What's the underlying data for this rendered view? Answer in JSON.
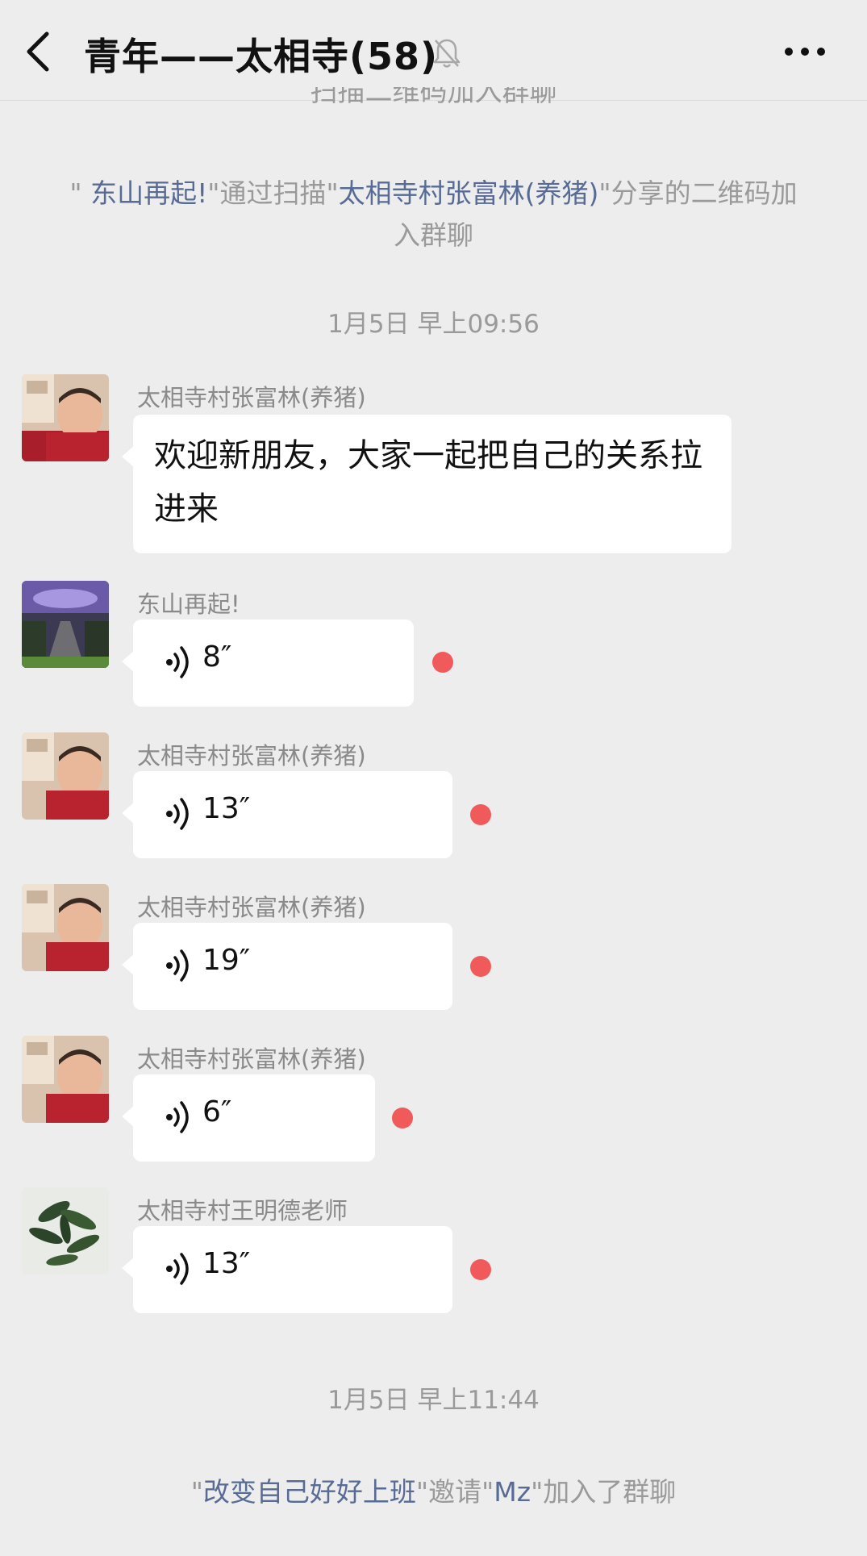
{
  "header": {
    "title": "青年——太相寺(58)",
    "back_icon": "chevron-left-icon",
    "mute_icon": "bell-off-icon",
    "more_icon": "more-horizontal-icon"
  },
  "cutoff_text": "扫描二维码加入群聊",
  "system_messages": [
    {
      "q1": "\"",
      "user": " 东山再起!",
      "mid": "\"通过扫描\"",
      "sharer": "太相寺村张富林(养猪)",
      "tail": "\"分享的二维码加入群聊"
    },
    {
      "q1": "\"",
      "user": "改变自己好好上班",
      "mid": "\"邀请\"",
      "sharer": "Mz",
      "tail": "\"加入了群聊"
    }
  ],
  "times": [
    "1月5日 早上09:56",
    "1月5日 早上11:44"
  ],
  "messages": [
    {
      "sender": "太相寺村张富林(养猪)",
      "text": "欢迎新朋友，大家一起把自己的关系拉进来"
    },
    {
      "sender": "东山再起!",
      "duration": "8″"
    },
    {
      "sender": "太相寺村张富林(养猪)",
      "duration": "13″"
    },
    {
      "sender": "太相寺村张富林(养猪)",
      "duration": "19″"
    },
    {
      "sender": "太相寺村张富林(养猪)",
      "duration": "6″"
    },
    {
      "sender": "太相寺村王明德老师",
      "duration": "13″"
    }
  ],
  "colors": {
    "background": "#ededed",
    "link": "#576b95",
    "unread_dot": "#f05a5a",
    "bubble": "#ffffff"
  }
}
